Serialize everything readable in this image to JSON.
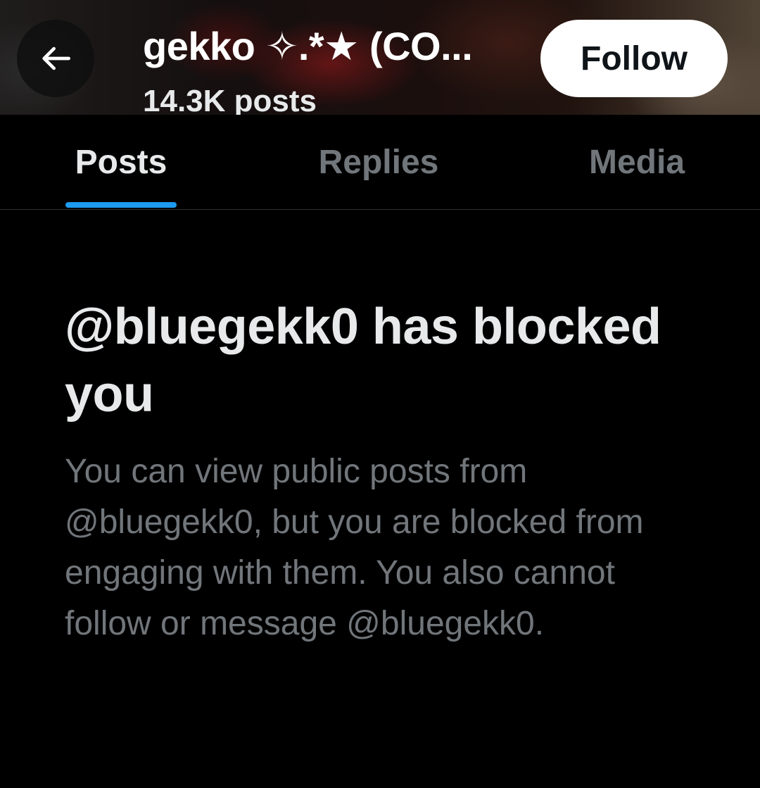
{
  "header": {
    "back_icon": "arrow-left-icon",
    "display_name": "gekko ✧.*★ (CO...",
    "post_count": "14.3K posts",
    "follow_label": "Follow"
  },
  "tabs": [
    {
      "label": "Posts",
      "active": true
    },
    {
      "label": "Replies",
      "active": false
    },
    {
      "label": "Media",
      "active": false
    }
  ],
  "blocked": {
    "title": "@bluegekk0 has blocked you",
    "body": "You can view public posts from @bluegekk0, but you are blocked from engaging with them. You also cannot follow or message @bluegekk0."
  },
  "colors": {
    "background": "#000000",
    "accent": "#1d9bf0",
    "primary_text": "#e7e9ea",
    "secondary_text": "#71767b",
    "follow_button_bg": "#ffffff"
  }
}
